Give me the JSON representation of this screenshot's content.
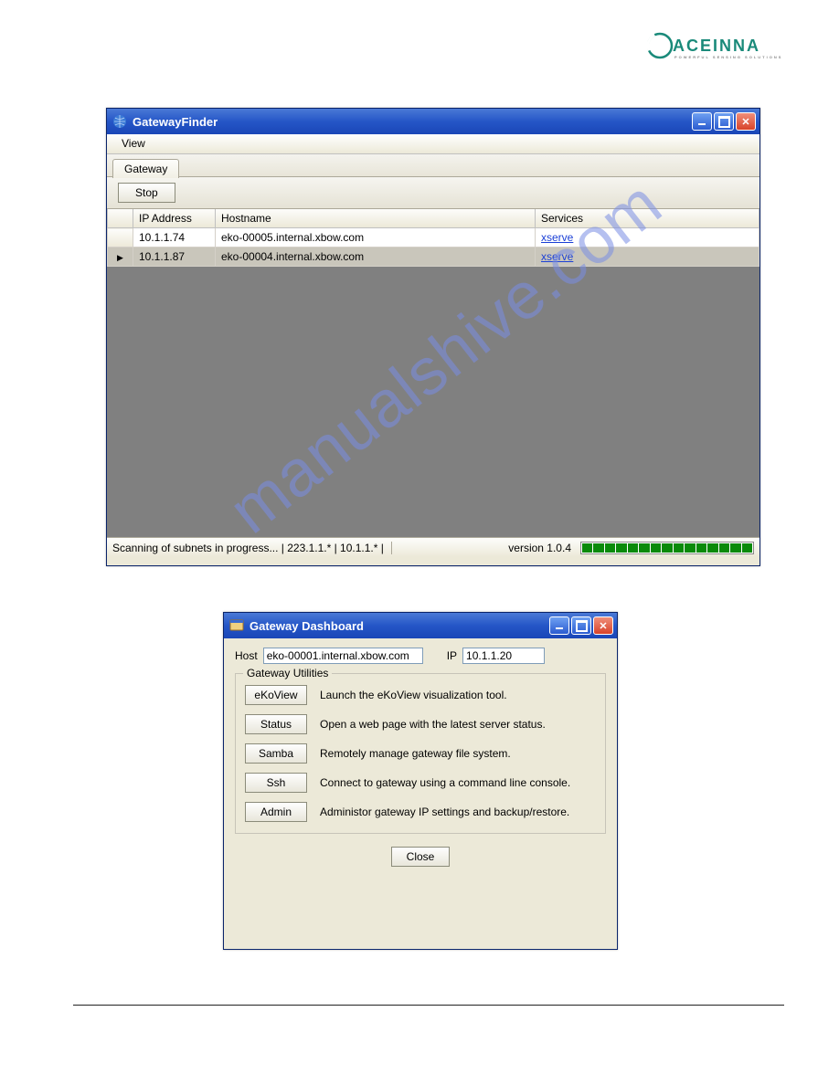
{
  "logo_text": "ACEINNA",
  "watermark": "manualshive.com",
  "win1": {
    "title": "GatewayFinder",
    "menu": {
      "view": "View"
    },
    "tab": "Gateway",
    "stop_btn": "Stop",
    "columns": {
      "ip": "IP Address",
      "host": "Hostname",
      "svc": "Services"
    },
    "rows": [
      {
        "ip": "10.1.1.74",
        "host": "eko-00005.internal.xbow.com",
        "svc": "xserve",
        "selected": false
      },
      {
        "ip": "10.1.1.87",
        "host": "eko-00004.internal.xbow.com",
        "svc": "xserve",
        "selected": true
      }
    ],
    "status_left": "Scanning of subnets in progress... | 223.1.1.* | 10.1.1.* |",
    "version": "version 1.0.4"
  },
  "win2": {
    "title": "Gateway Dashboard",
    "host_label": "Host",
    "host_value": "eko-00001.internal.xbow.com",
    "ip_label": "IP",
    "ip_value": "10.1.1.20",
    "legend": "Gateway Utilities",
    "utils": [
      {
        "btn": "eKoView",
        "desc": "Launch the eKoView visualization tool."
      },
      {
        "btn": "Status",
        "desc": "Open a web page with the latest server status."
      },
      {
        "btn": "Samba",
        "desc": "Remotely manage gateway file system."
      },
      {
        "btn": "Ssh",
        "desc": "Connect to gateway using a command line console."
      },
      {
        "btn": "Admin",
        "desc": "Administor gateway IP settings and backup/restore."
      }
    ],
    "close_btn": "Close"
  }
}
